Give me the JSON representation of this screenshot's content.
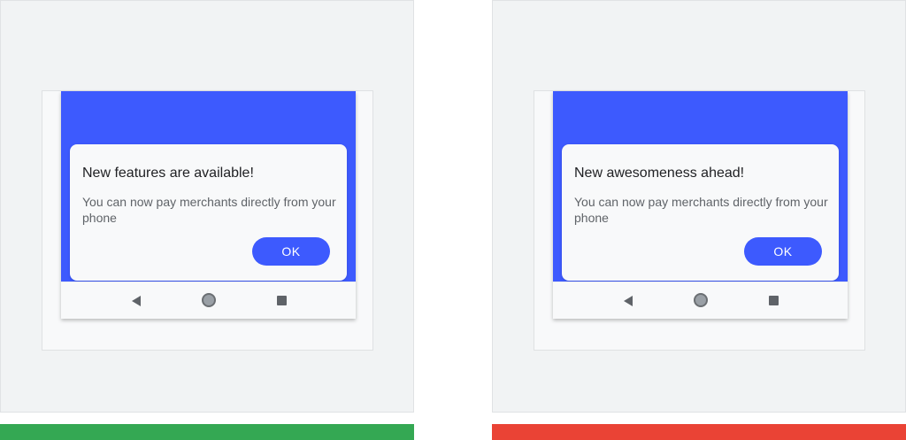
{
  "colors": {
    "panel_background": "#f1f3f4",
    "brand_blue": "#3d5afe",
    "do_bar": "#34a853",
    "dont_bar": "#ea4335"
  },
  "examples": [
    {
      "verdict_color_name": "green",
      "dialog": {
        "title": "New features are available!",
        "body": "You can now pay merchants directly from your phone",
        "button_label": "OK"
      },
      "nav_icons": [
        "back-icon",
        "home-icon",
        "recents-icon"
      ]
    },
    {
      "verdict_color_name": "red",
      "dialog": {
        "title": "New awesomeness ahead!",
        "body": "You can now pay merchants directly from your phone",
        "button_label": "OK"
      },
      "nav_icons": [
        "back-icon",
        "home-icon",
        "recents-icon"
      ]
    }
  ]
}
